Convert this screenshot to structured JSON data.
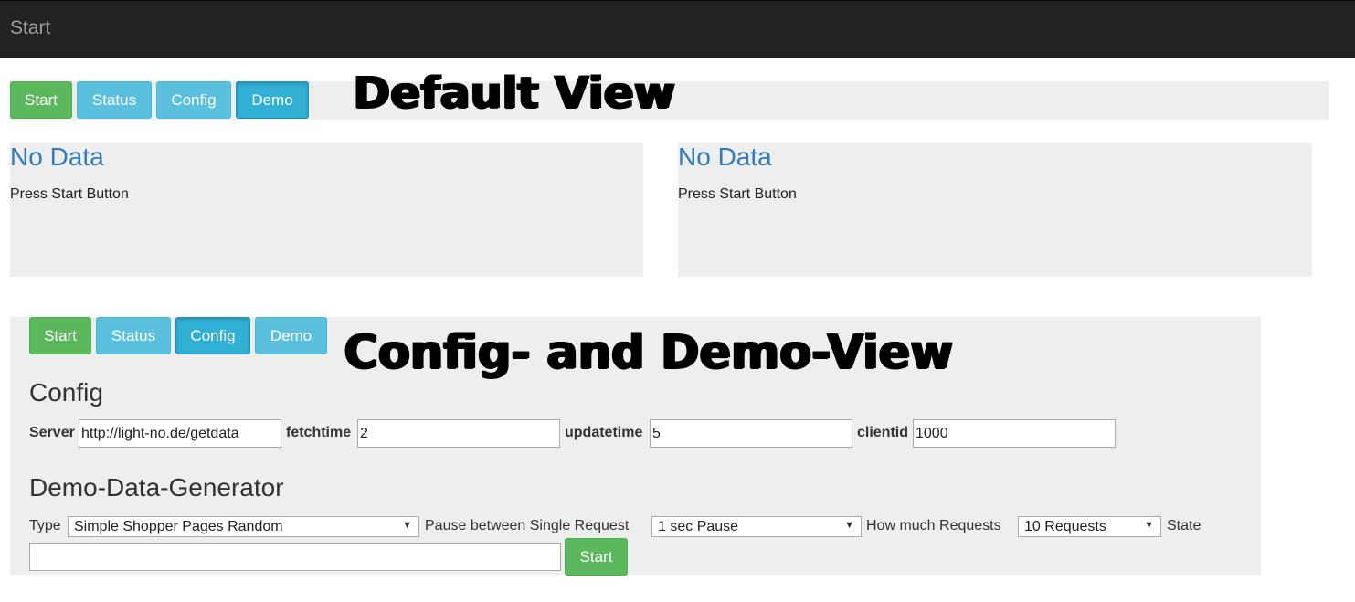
{
  "navbar": {
    "brand": "Start"
  },
  "default_view": {
    "heading": "Default View",
    "buttons": {
      "start": "Start",
      "status": "Status",
      "config": "Config",
      "demo": "Demo"
    },
    "panels": [
      {
        "title": "No Data",
        "text": "Press Start Button"
      },
      {
        "title": "No Data",
        "text": "Press Start Button"
      }
    ]
  },
  "config_view": {
    "heading": "Config- and Demo-View",
    "buttons": {
      "start": "Start",
      "status": "Status",
      "config": "Config",
      "demo": "Demo"
    },
    "config": {
      "title": "Config",
      "server_label": "Server",
      "server_value": "http://light-no.de/getdata",
      "fetchtime_label": "fetchtime",
      "fetchtime_value": "2",
      "updatetime_label": "updatetime",
      "updatetime_value": "5",
      "clientid_label": "clientid",
      "clientid_value": "1000"
    },
    "demo": {
      "title": "Demo-Data-Generator",
      "type_label": "Type",
      "type_value": "Simple Shopper Pages Random",
      "pause_label": "Pause between Single Request",
      "pause_value": "1 sec Pause",
      "requests_label": "How much Requests",
      "requests_value": "10 Requests",
      "state_label": "State",
      "state_value": "",
      "start_button": "Start"
    }
  },
  "icons": {
    "dropdown": "chevron-down-icon",
    "dropdown_glyph": "▼"
  },
  "colors": {
    "navbar": "#222222",
    "success": "#5cb85c",
    "info": "#5bc0de",
    "link": "#337ab7",
    "panel": "#eeeeee"
  }
}
